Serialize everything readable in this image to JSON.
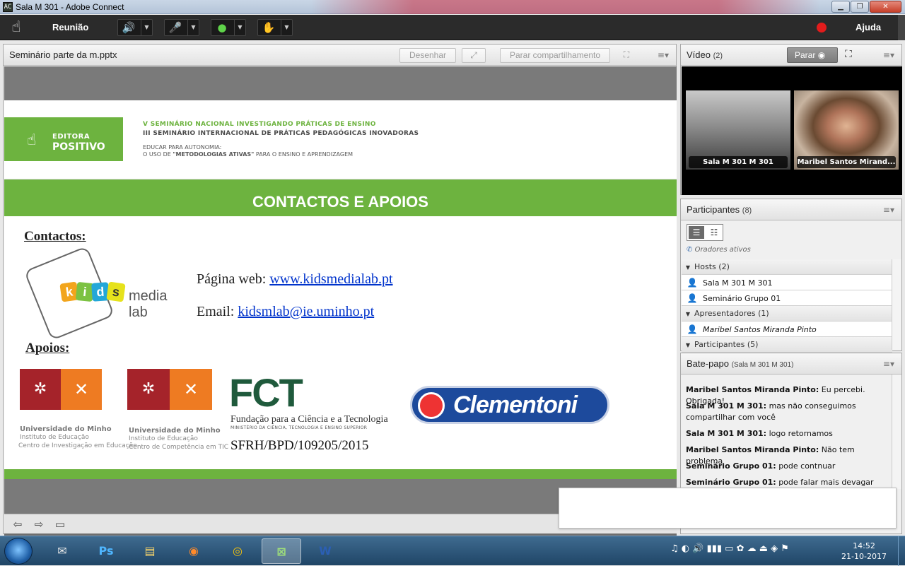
{
  "window": {
    "app_icon": "adobe-connect-icon",
    "title": "Sala M 301 - Adobe Connect",
    "buttons": {
      "min": "▁",
      "max": "❐",
      "close": "✕"
    }
  },
  "toolbar": {
    "menu_reuniao": "Reunião",
    "menu_ajuda": "Ajuda",
    "icons": {
      "speaker": "🔊",
      "mic": "🎤",
      "camera": "●",
      "hand": "✋",
      "dropdown": "▼"
    }
  },
  "share_pod": {
    "title": "Seminário parte da m.pptx",
    "btn_desenhar": "Desenhar",
    "btn_parar": "Parar compartilhamento",
    "menu": "≡▾",
    "slide": {
      "logo_line1": "EDITORA",
      "logo_line2": "POSITIVO",
      "seminar_line1": "V SEMINÁRIO NACIONAL INVESTIGANDO PRÁTICAS DE ENSINO",
      "seminar_line2": "III SEMINÁRIO INTERNACIONAL DE PRÁTICAS PEDAGÓGICAS INOVADORAS",
      "seminar_line3": "EDUCAR PARA AUTONOMIA:",
      "seminar_line4_a": "O USO DE ",
      "seminar_line4_b": "\"METODOLOGIAS ATIVAS\"",
      "seminar_line4_c": " PARA O ENSINO E APRENDIZAGEM",
      "heading": "CONTACTOS E APOIOS",
      "contactos_label": "Contactos:",
      "kids_letters": [
        "k",
        "i",
        "d",
        "s"
      ],
      "kids_suffix": "media lab",
      "web_label": "Página web: ",
      "web_link": "www.kidsmedialab.pt",
      "email_label": "Email: ",
      "email_link": "kidsmlab@ie.uminho.pt",
      "apoios_label": "Apoios:",
      "um1": {
        "name": "Universidade do Minho",
        "sub1": "Instituto de Educação",
        "sub2": "Centro de Investigação em Educação"
      },
      "um2": {
        "name": "Universidade do Minho",
        "sub1": "Instituto de Educação",
        "sub2": "Centro de Competência em TIC"
      },
      "fct": "FCT",
      "fct_sub": "Fundação para a Ciência e a Tecnologia",
      "fct_sub2": "MINISTÉRIO DA CIÊNCIA, TECNOLOGIA E ENSINO SUPERIOR",
      "sfrh": "SFRH/BPD/109205/2015",
      "clementoni": "Clementoni"
    }
  },
  "video_pod": {
    "title": "Vídeo",
    "count": "(2)",
    "btn_parar": "Parar",
    "feeds": [
      "Sala M 301 M 301",
      "Maribel Santos Mirand..."
    ]
  },
  "participants_pod": {
    "title": "Participantes",
    "count": "(8)",
    "oradores": "Oradores ativos",
    "rows": [
      {
        "type": "cat",
        "label": "Hosts (2)"
      },
      {
        "type": "item",
        "label": "Sala M 301 M 301"
      },
      {
        "type": "item",
        "label": "Seminário Grupo 01"
      },
      {
        "type": "cat",
        "label": "Apresentadores (1)"
      },
      {
        "type": "item",
        "label": "Maribel Santos Miranda  Pinto"
      },
      {
        "type": "cat",
        "label": "Participantes (5)"
      }
    ]
  },
  "chat_pod": {
    "title": "Bate-papo",
    "subtitle": "(Sala M 301 M 301)",
    "messages": [
      {
        "sender": "Maribel Santos Miranda  Pinto:",
        "text": " Eu percebi. Obrigada!"
      },
      {
        "sender": "Sala M 301 M 301:",
        "text": " mas não conseguimos compartilhar com você"
      },
      {
        "sender": "Sala M 301 M 301:",
        "text": " logo retornamos"
      },
      {
        "sender": "Maribel Santos Miranda  Pinto:",
        "text": " Não tem problema"
      },
      {
        "sender": "Seminário Grupo 01:",
        "text": " pode contnuar"
      },
      {
        "sender": "Seminário Grupo 01:",
        "text": " pode falar mais devagar"
      }
    ]
  },
  "taskbar": {
    "apps": [
      {
        "name": "thunderbird",
        "glyph": "✉"
      },
      {
        "name": "photoshop",
        "glyph": "Ps"
      },
      {
        "name": "explorer",
        "glyph": "▤"
      },
      {
        "name": "firefox",
        "glyph": "◉"
      },
      {
        "name": "chrome",
        "glyph": "◎"
      },
      {
        "name": "adobe-connect",
        "glyph": "⊠"
      },
      {
        "name": "word",
        "glyph": "W"
      }
    ],
    "time": "14:52",
    "date": "21-10-2017"
  },
  "colors": {
    "slide_green": "#6db33f",
    "um_red": "#a5232a",
    "um_orange": "#ee7b22",
    "fct_green": "#1f5a3c",
    "clementoni_blue": "#1d4a9c"
  }
}
